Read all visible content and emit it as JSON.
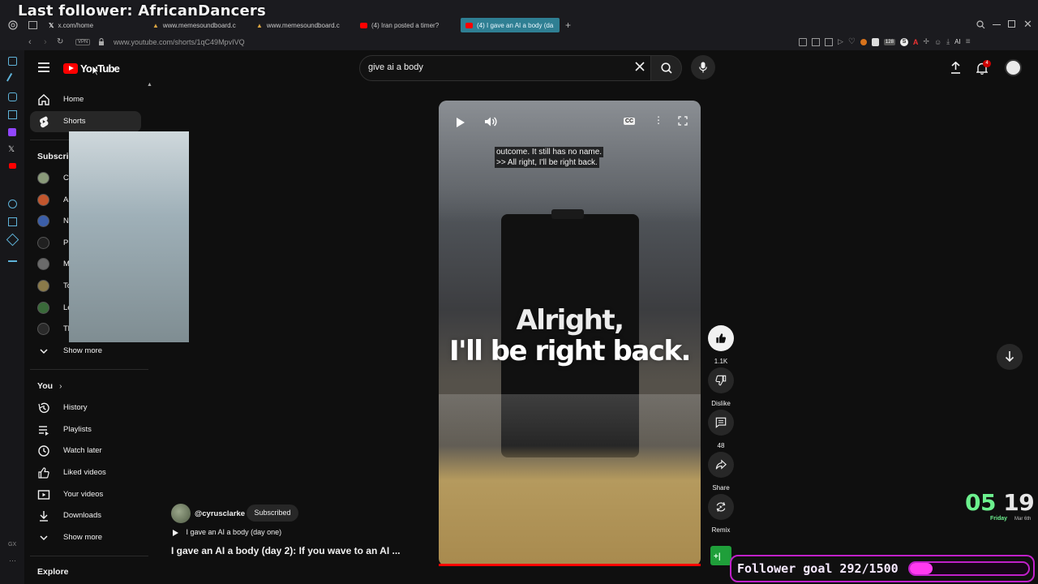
{
  "overlay": {
    "title": "Last follower: AfricanDancers"
  },
  "browser": {
    "tabs": [
      {
        "label": "x.com/home"
      },
      {
        "label": "www.memesoundboard.c"
      },
      {
        "label": "www.memesoundboard.c"
      },
      {
        "label": "(4) Iran posted a timer?"
      },
      {
        "label": "(4) I gave an AI a body (da"
      }
    ],
    "vpn_label": "VPN",
    "url": "www.youtube.com/shorts/1qC49MpvIVQ",
    "ai_label": "AI",
    "badge_count": "128"
  },
  "masthead": {
    "logo_text": "YouTube",
    "search_value": "give ai a body",
    "notifications_count": "4"
  },
  "sidebar": {
    "main": [
      {
        "label": "Home"
      },
      {
        "label": "Shorts"
      }
    ],
    "subscriptions_header": "Subscriptions",
    "subscriptions": [
      {
        "label": "Cyrus Clarke",
        "color": "#8a9a7a"
      },
      {
        "label": "Asmongold TV",
        "color": "#c2562d"
      },
      {
        "label": "Nuxanor",
        "color": "#3b5ea8"
      },
      {
        "label": "Pink Floyd",
        "color": "#202020"
      },
      {
        "label": "Michael Franzese",
        "color": "#6a6a6a"
      },
      {
        "label": "Toxic Stoner",
        "color": "#8a7a4a"
      },
      {
        "label": "Led Zeppelin",
        "color": "#3a6a3a"
      },
      {
        "label": "The Hics",
        "color": "#2a2a2a"
      }
    ],
    "show_more_1": "Show more",
    "you_header": "You",
    "you": [
      {
        "label": "History"
      },
      {
        "label": "Playlists"
      },
      {
        "label": "Watch later"
      },
      {
        "label": "Liked videos"
      },
      {
        "label": "Your videos"
      },
      {
        "label": "Downloads"
      }
    ],
    "show_more_2": "Show more",
    "explore_header": "Explore"
  },
  "video": {
    "caption_line1": "outcome. It still has no name.",
    "caption_line2": ">> All right, I'll be right back.",
    "overlay_line1": "Alright,",
    "overlay_line2": "I'll be right back.",
    "cc_label": "CC"
  },
  "actions": {
    "likes": "1.1K",
    "dislike_label": "Dislike",
    "comments": "48",
    "share_label": "Share",
    "remix_label": "Remix"
  },
  "channel": {
    "handle": "@cyrusclarke",
    "subscribed_label": "Subscribed",
    "playlist_label": "I gave an AI a body (day one)",
    "title": "I gave an AI a body (day 2): If you wave to an AI ..."
  },
  "stream": {
    "clock_hours": "05",
    "clock_minutes": "19",
    "day": "Friday",
    "date": "Mar 6th",
    "goal_text": "Follower goal 292/1500",
    "goal_current": 292,
    "goal_target": 1500
  },
  "colors": {
    "accent_red": "#ff0000",
    "goal_magenta": "#c020c9",
    "clock_green": "#6cf08e"
  }
}
